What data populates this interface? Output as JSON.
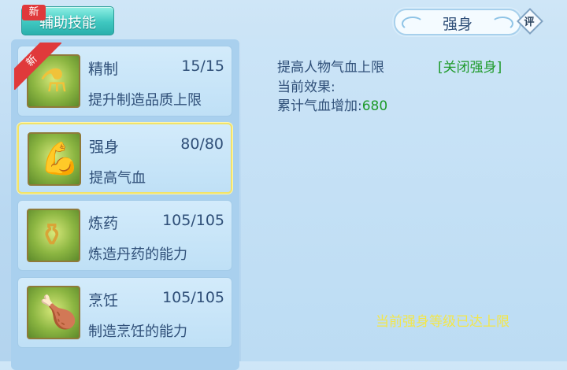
{
  "tabs": {
    "active_label": "辅助技能",
    "new_tag": "新"
  },
  "header": {
    "title": "强身",
    "rate_label": "评"
  },
  "skills": [
    {
      "name": "精制",
      "level": "15/15",
      "desc": "提升制造品质上限",
      "new_tag": "新",
      "icon": "refine-icon"
    },
    {
      "name": "强身",
      "level": "80/80",
      "desc": "提高气血",
      "icon": "strength-icon"
    },
    {
      "name": "炼药",
      "level": "105/105",
      "desc": "炼造丹药的能力",
      "icon": "alchemy-cauldron-icon"
    },
    {
      "name": "烹饪",
      "level": "105/105",
      "desc": "制造烹饪的能力",
      "icon": "meat-leg-icon"
    }
  ],
  "detail": {
    "effect_desc": "提高人物气血上限",
    "toggle_label": "[关闭强身]",
    "current_effect_label": "当前效果:",
    "bonus_label": "累计气血增加:",
    "bonus_value": "680",
    "max_note": "当前强身等级已达上限"
  },
  "colors": {
    "accent_teal": "#3fc7c0",
    "highlight_green": "#1e9a2a",
    "notice_yellow": "#f3e64a",
    "new_red": "#e0393b",
    "selected_border": "#f1e36a"
  }
}
